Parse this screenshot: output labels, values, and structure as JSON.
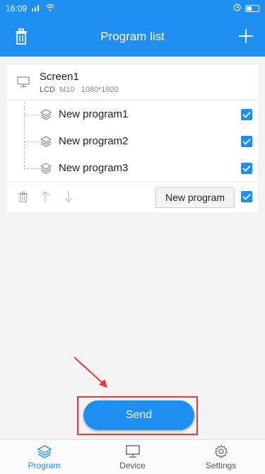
{
  "status_bar": {
    "time": "16:09",
    "signal": "⋮││",
    "wifi": "≈",
    "right_icons": "∆ ◎ ◷"
  },
  "header": {
    "title": "Program list"
  },
  "screen": {
    "name": "Screen1",
    "type": "LCD",
    "model": "M10",
    "resolution": "1080*1920"
  },
  "programs": [
    {
      "name": "New program1",
      "checked": true
    },
    {
      "name": "New program2",
      "checked": true
    },
    {
      "name": "New program3",
      "checked": true
    }
  ],
  "actions": {
    "new_program_label": "New program",
    "select_all_checked": true
  },
  "send_label": "Send",
  "tabs": [
    {
      "label": "Program",
      "active": true,
      "icon": "layers-icon"
    },
    {
      "label": "Device",
      "active": false,
      "icon": "monitor-icon"
    },
    {
      "label": "Settings",
      "active": false,
      "icon": "gear-icon"
    }
  ],
  "colors": {
    "primary": "#1e8ff0",
    "highlight": "#e53935"
  }
}
